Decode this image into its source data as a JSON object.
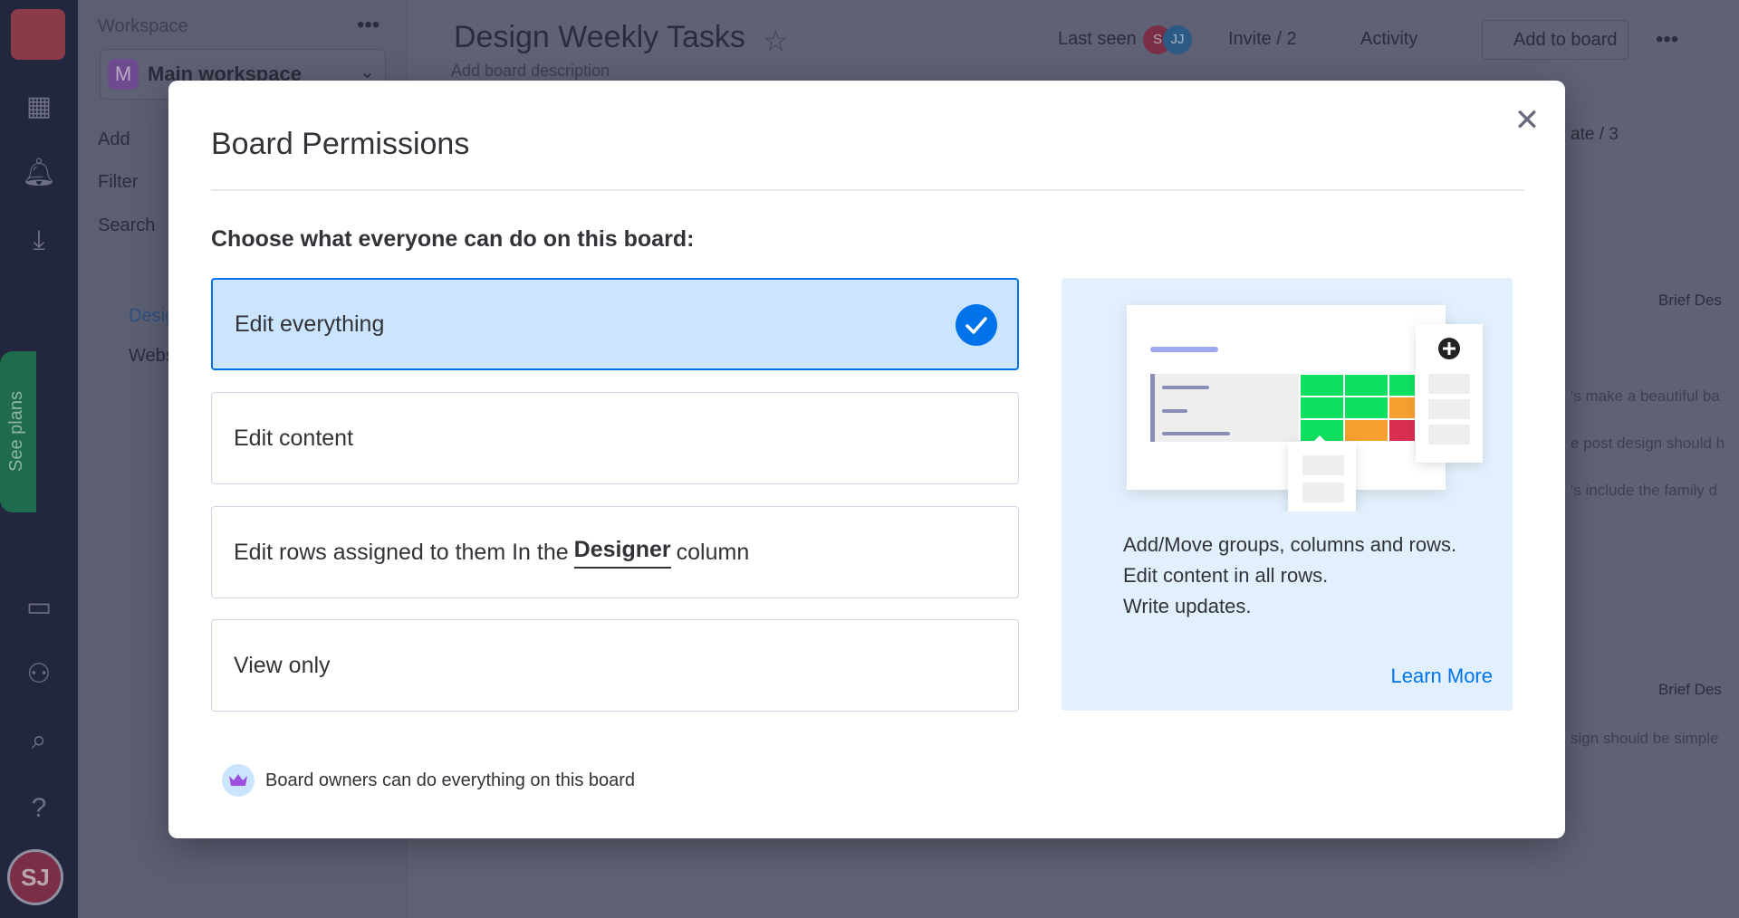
{
  "rail": {
    "see_plans": "See plans",
    "avatar": "SJ"
  },
  "workspace": {
    "label": "Workspace",
    "name": "Main workspace",
    "initial": "M",
    "add": "Add",
    "filter": "Filter",
    "search": "Search",
    "boards": [
      "Design",
      "Website"
    ]
  },
  "header": {
    "title": "Design Weekly Tasks",
    "description": "Add board description",
    "last_seen": "Last seen",
    "avatars": [
      "S",
      "JJ"
    ],
    "invite": "Invite / 2",
    "activity": "Activity",
    "add_to_board": "Add to board",
    "automate": "ate / 3"
  },
  "background_rows": {
    "column": "Brief Des",
    "rows": [
      "'s make a beautiful ba",
      "e post design should h",
      "'s include the family d"
    ],
    "column2": "Brief Des",
    "row2": "sign should be simple"
  },
  "modal": {
    "title": "Board Permissions",
    "heading": "Choose what everyone can do on this board:",
    "options": [
      {
        "label": "Edit everything",
        "selected": true
      },
      {
        "label": "Edit content",
        "selected": false
      },
      {
        "label_pre": "Edit rows assigned to them In the",
        "label_bold": "Designer",
        "label_post": "column",
        "selected": false
      },
      {
        "label": "View only",
        "selected": false
      }
    ],
    "description": [
      "Add/Move groups, columns and rows.",
      "Edit content in all rows.",
      "Write updates."
    ],
    "learn_more": "Learn More",
    "footer": "Board owners can do everything on this board"
  },
  "colors": {
    "accent": "#0073ea",
    "selected_bg": "#cce5ff",
    "panel_bg": "#e1f0fc",
    "green": "#00e060",
    "orange": "#f5a030",
    "red": "#d82f50"
  }
}
